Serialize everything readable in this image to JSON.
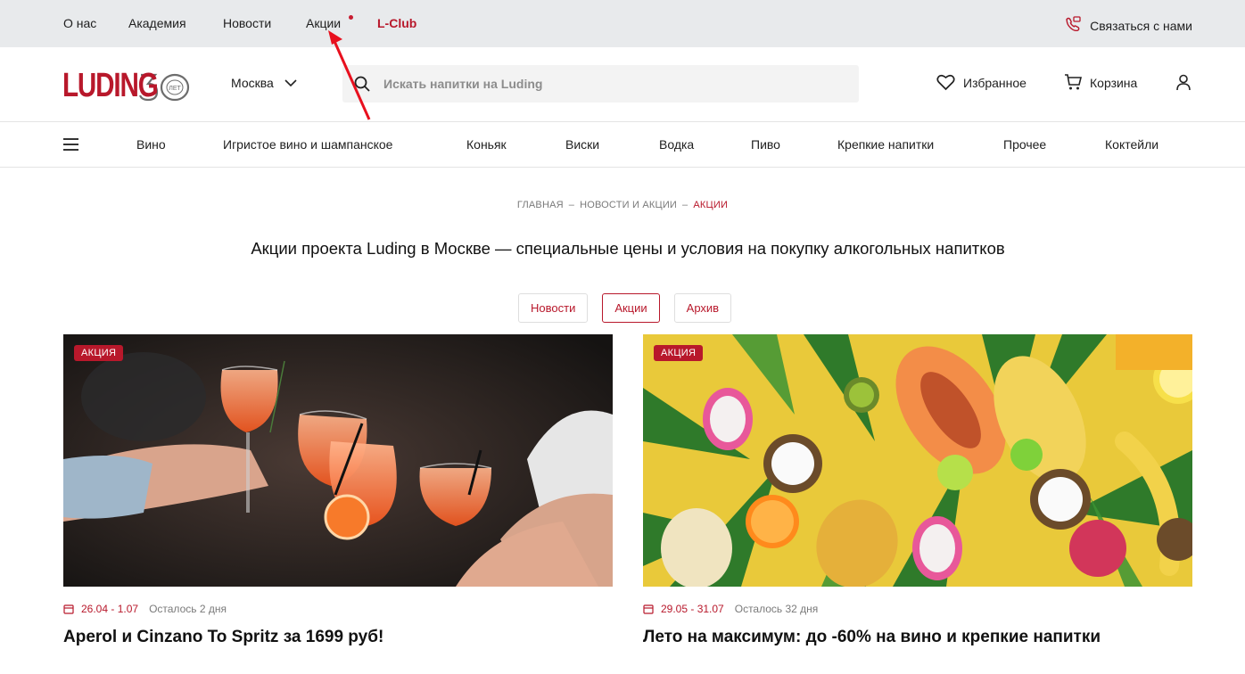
{
  "topbar": {
    "links": [
      "О нас",
      "Академия",
      "Новости",
      "Акции",
      "L-Club"
    ],
    "contact": "Связаться с нами"
  },
  "header": {
    "logo": "LUDING",
    "logo_badge": "ЛЕТ",
    "city": "Москва",
    "search_placeholder": "Искать напитки на Luding",
    "favorites": "Избранное",
    "cart": "Корзина"
  },
  "categories": [
    "Вино",
    "Игристое вино и шампанское",
    "Коньяк",
    "Виски",
    "Водка",
    "Пиво",
    "Крепкие напитки",
    "Прочее",
    "Коктейли"
  ],
  "breadcrumb": [
    "ГЛАВНАЯ",
    "НОВОСТИ И АКЦИИ",
    "АКЦИИ"
  ],
  "title": "Акции проекта Luding в Москве — специальные цены и условия на покупку алкогольных напитков",
  "tabs": [
    "Новости",
    "Акции",
    "Архив"
  ],
  "cards": [
    {
      "badge": "АКЦИЯ",
      "dates": "26.04 - 1.07",
      "remaining": "Осталось 2 дня",
      "title": "Aperol и Cinzano To Spritz за 1699 руб!"
    },
    {
      "badge": "АКЦИЯ",
      "dates": "29.05 - 31.07",
      "remaining": "Осталось 32 дня",
      "title": "Лето на максимум: до -60% на вино и крепкие напитки"
    }
  ],
  "colors": {
    "brand": "#b8182b",
    "topbar_bg": "#e8eaec"
  }
}
